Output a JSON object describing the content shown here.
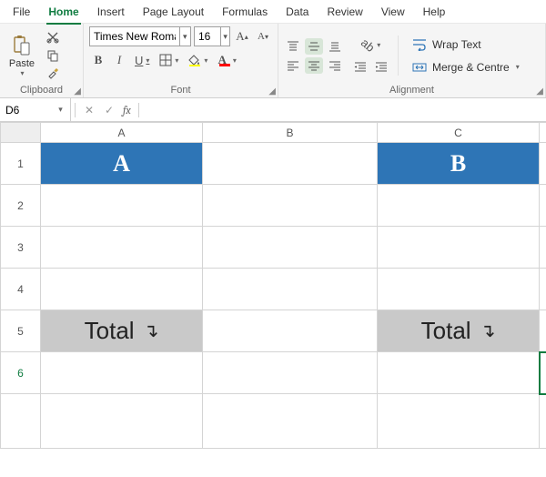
{
  "menu": {
    "items": [
      "File",
      "Home",
      "Insert",
      "Page Layout",
      "Formulas",
      "Data",
      "Review",
      "View",
      "Help"
    ],
    "active_index": 1
  },
  "ribbon": {
    "clipboard": {
      "title": "Clipboard",
      "paste": "Paste"
    },
    "font": {
      "title": "Font",
      "family": "Times New Roman",
      "size": "16",
      "bold": "B",
      "italic": "I",
      "underline": "U"
    },
    "alignment": {
      "title": "Alignment",
      "wrap": "Wrap Text",
      "merge": "Merge & Centre"
    }
  },
  "formula_bar": {
    "name": "D6",
    "fx": "fx",
    "value": ""
  },
  "grid": {
    "col_headers": [
      "A",
      "B",
      "C"
    ],
    "row_headers": [
      "1",
      "2",
      "3",
      "4",
      "5",
      "6"
    ],
    "active_row_index": 5,
    "cells": {
      "A1": "A",
      "C1": "B",
      "A5": "Total",
      "C5": "Total",
      "arrow": "↴"
    },
    "header_fill": "#2e75b6",
    "total_fill": "#c9c9c9"
  }
}
